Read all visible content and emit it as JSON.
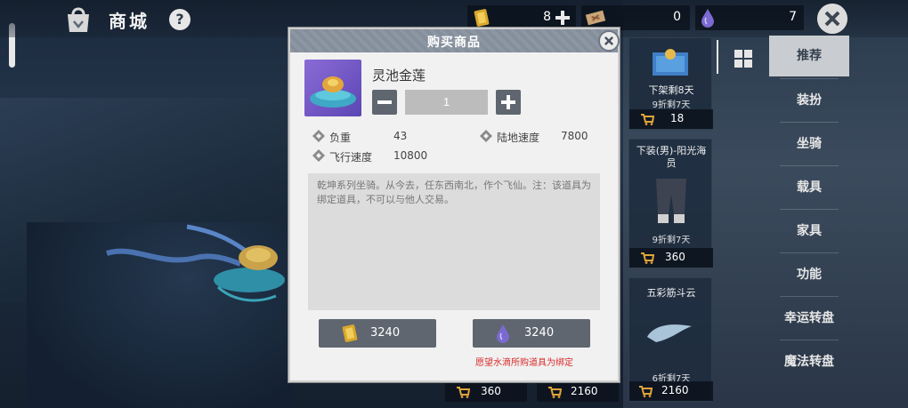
{
  "header": {
    "title": "商城",
    "help_label": "?",
    "currencies": [
      {
        "icon": "gold-bar-icon",
        "value": "8"
      },
      {
        "icon": "ticket-icon",
        "value": "0"
      },
      {
        "icon": "crystal-drop-icon",
        "value": "7"
      }
    ]
  },
  "categories": [
    {
      "label": "推荐",
      "active": true
    },
    {
      "label": "装扮",
      "active": false
    },
    {
      "label": "坐骑",
      "active": false
    },
    {
      "label": "载具",
      "active": false
    },
    {
      "label": "家具",
      "active": false
    },
    {
      "label": "功能",
      "active": false
    },
    {
      "label": "幸运转盘",
      "active": false
    },
    {
      "label": "魔法转盘",
      "active": false
    }
  ],
  "products": [
    {
      "name": "下架剩8天",
      "discount": "9折剩7天",
      "price": "18"
    },
    {
      "name": "下装(男)-阳光海员",
      "discount": "9折剩7天",
      "price": "360"
    },
    {
      "name": "五彩筋斗云",
      "discount": "6折剩7天",
      "price": "2160"
    }
  ],
  "bottom_prices": [
    "360",
    "2160"
  ],
  "dialog": {
    "title": "购买商品",
    "item_name": "灵池金莲",
    "quantity": "1",
    "stats": [
      {
        "label": "负重",
        "value": "43"
      },
      {
        "label": "陆地速度",
        "value": "7800"
      },
      {
        "label": "飞行速度",
        "value": "10800"
      }
    ],
    "description": "乾坤系列坐骑。从今去，任东西南北，作个飞仙。注：该道具为绑定道具，不可以与他人交易。",
    "buy_gold_price": "3240",
    "buy_crystal_price": "3240",
    "warning": "愿望水滴所购道具为绑定"
  },
  "colors": {
    "dialog_bg": "#f1f1f1",
    "header_bar": "#8d96a3",
    "button": "#5f6670",
    "warning": "#d92b2b",
    "active_category": "#c9ccd0"
  }
}
